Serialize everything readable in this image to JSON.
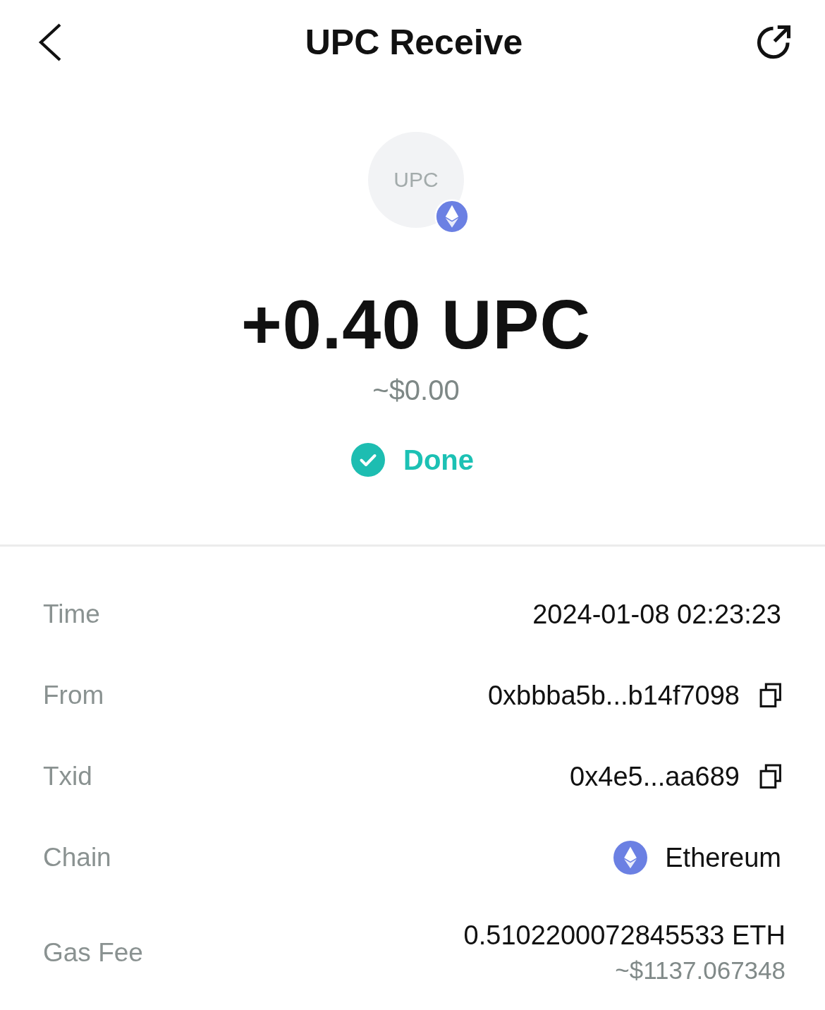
{
  "header": {
    "title": "UPC Receive"
  },
  "token": {
    "symbol": "UPC"
  },
  "amount": "+0.40 UPC",
  "fiat": "~$0.00",
  "status": {
    "kind": "done",
    "label": "Done"
  },
  "details": [
    {
      "kind": "text",
      "label": "Time",
      "value": "2024-01-08 02:23:23"
    },
    {
      "kind": "copy",
      "label": "From",
      "value": "0xbbba5b...b14f7098"
    },
    {
      "kind": "copy",
      "label": "Txid",
      "value": "0x4e5...aa689"
    },
    {
      "kind": "chain",
      "label": "Chain",
      "value": "Ethereum"
    },
    {
      "kind": "amount",
      "label": "Gas Fee",
      "value": "0.5102200072845533 ETH",
      "sub": "~$1137.067348"
    }
  ]
}
